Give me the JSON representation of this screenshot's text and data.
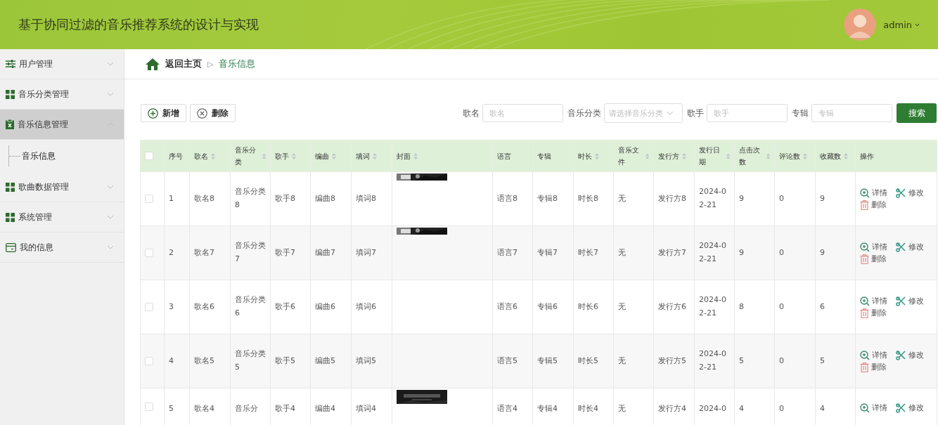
{
  "header": {
    "title": "基于协同过滤的音乐推荐系统的设计与实现",
    "user": "admin"
  },
  "sidebar": {
    "items": [
      {
        "label": "用户管理",
        "expanded": false
      },
      {
        "label": "音乐分类管理",
        "expanded": false
      },
      {
        "label": "音乐信息管理",
        "expanded": true,
        "children": [
          {
            "label": "音乐信息"
          }
        ]
      },
      {
        "label": "歌曲数据管理",
        "expanded": false
      },
      {
        "label": "系统管理",
        "expanded": false
      },
      {
        "label": "我的信息",
        "expanded": false
      }
    ]
  },
  "breadcrumb": {
    "home": "返回主页",
    "separator": "▷",
    "current": "音乐信息"
  },
  "toolbar": {
    "buttons": [
      {
        "label": "新增",
        "kind": "add"
      },
      {
        "label": "删除",
        "kind": "delete"
      }
    ],
    "filters": [
      {
        "label": "歌名",
        "placeholder": "歌名",
        "kind": "input"
      },
      {
        "label": "音乐分类",
        "placeholder": "请选择音乐分类",
        "kind": "select"
      },
      {
        "label": "歌手",
        "placeholder": "歌手",
        "kind": "input"
      },
      {
        "label": "专辑",
        "placeholder": "专辑",
        "kind": "input"
      }
    ],
    "search": "搜索"
  },
  "table": {
    "all_checked": false,
    "columns": [
      {
        "label": "序号",
        "sortable": false
      },
      {
        "label": "歌名",
        "sortable": true
      },
      {
        "label": "音乐分类",
        "sortable": true
      },
      {
        "label": "歌手",
        "sortable": true
      },
      {
        "label": "编曲",
        "sortable": true
      },
      {
        "label": "填词",
        "sortable": true
      },
      {
        "label": "封面",
        "sortable": true
      },
      {
        "label": "语言",
        "sortable": false
      },
      {
        "label": "专辑",
        "sortable": false
      },
      {
        "label": "时长",
        "sortable": true
      },
      {
        "label": "音乐文件",
        "sortable": true
      },
      {
        "label": "发行方",
        "sortable": true
      },
      {
        "label": "发行日期",
        "sortable": true
      },
      {
        "label": "点击次数",
        "sortable": true
      },
      {
        "label": "评论数",
        "sortable": true
      },
      {
        "label": "收藏数",
        "sortable": true
      },
      {
        "label": "操作",
        "sortable": false
      }
    ],
    "rows": [
      {
        "checked": false,
        "cells": [
          "1",
          "歌名8",
          "音乐分类8",
          "歌手8",
          "编曲8",
          "填词8",
          null,
          "语言8",
          "专辑8",
          "时长8",
          "无",
          "发行方8",
          "2024-02-21",
          "9",
          "0",
          "9"
        ],
        "cover": {
          "kind": "picture"
        },
        "actions": [
          "详情",
          "修改",
          "删除"
        ]
      },
      {
        "checked": false,
        "cells": [
          "2",
          "歌名7",
          "音乐分类7",
          "歌手7",
          "编曲7",
          "填词7",
          null,
          "语言7",
          "专辑7",
          "时长7",
          "无",
          "发行方7",
          "2024-02-21",
          "9",
          "0",
          "9"
        ],
        "cover": {
          "kind": "picture"
        },
        "actions": [
          "详情",
          "修改",
          "删除"
        ]
      },
      {
        "checked": false,
        "cells": [
          "3",
          "歌名6",
          "音乐分类6",
          "歌手6",
          "编曲6",
          "填词6",
          null,
          "语言6",
          "专辑6",
          "时长6",
          "无",
          "发行方6",
          "2024-02-21",
          "8",
          "0",
          "6"
        ],
        "actions": [
          "详情",
          "修改",
          "删除"
        ]
      },
      {
        "checked": false,
        "cells": [
          "4",
          "歌名5",
          "音乐分类5",
          "歌手5",
          "编曲5",
          "填词5",
          null,
          "语言5",
          "专辑5",
          "时长5",
          "无",
          "发行方5",
          "2024-02-21",
          "5",
          "0",
          "5"
        ],
        "actions": [
          "详情",
          "修改",
          "删除"
        ]
      },
      {
        "checked": false,
        "cells": [
          "5",
          "歌名4",
          "音乐分",
          "歌手4",
          "编曲4",
          "填词4",
          null,
          "语言4",
          "专辑4",
          "时长4",
          "无",
          "发行方4",
          "2024-0",
          "4",
          "0",
          "4"
        ],
        "cover": {
          "kind": "picture"
        },
        "actions": [
          "详情",
          "修改"
        ]
      }
    ]
  }
}
